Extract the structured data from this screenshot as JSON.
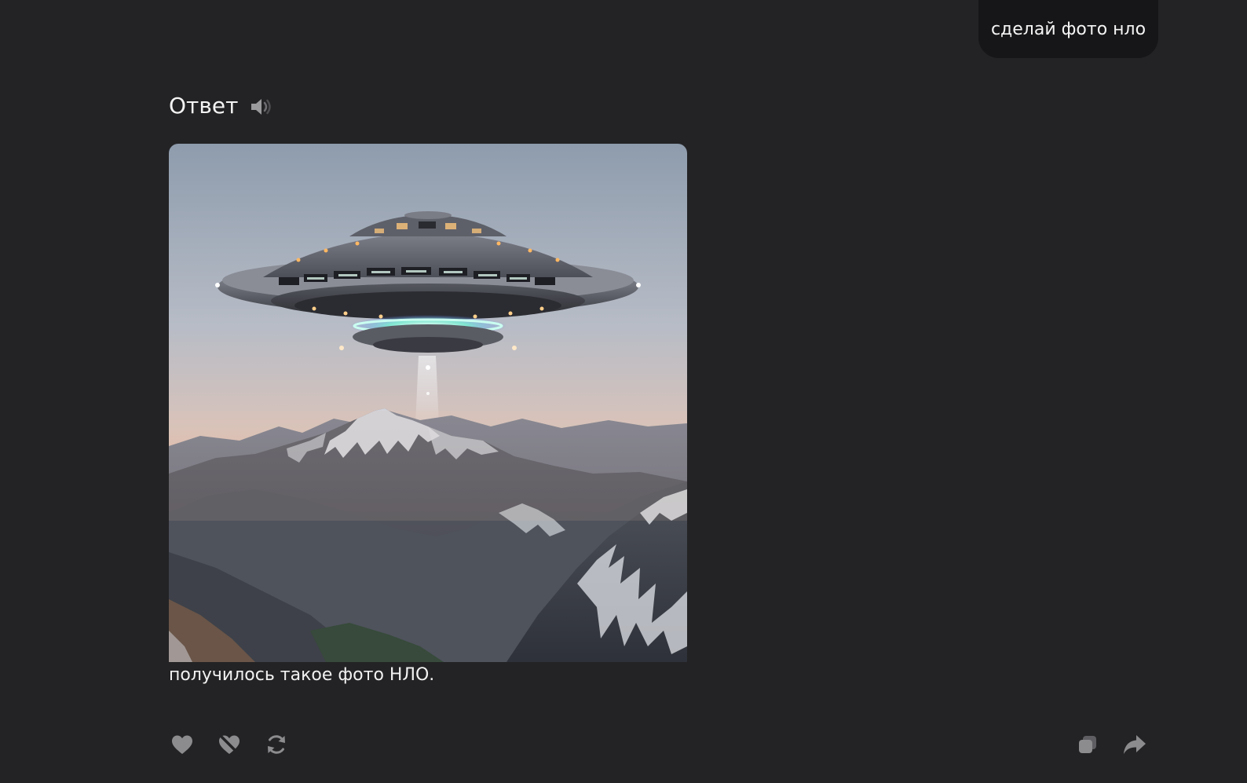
{
  "user_message": {
    "text": "сделай фото нло"
  },
  "answer": {
    "title": "Ответ",
    "image_subject": "UFO flying saucer over snowy mountains at dusk",
    "caption": "получилось такое фото НЛО."
  },
  "actions": {
    "like": "heart-icon",
    "dislike": "dislike-icon",
    "regenerate": "refresh-icon",
    "copy": "copy-icon",
    "share": "share-arrow-icon"
  },
  "colors": {
    "background": "#232325",
    "user_bubble": "#161618",
    "text": "#f2f2f2",
    "icon": "#8c8c8f"
  }
}
